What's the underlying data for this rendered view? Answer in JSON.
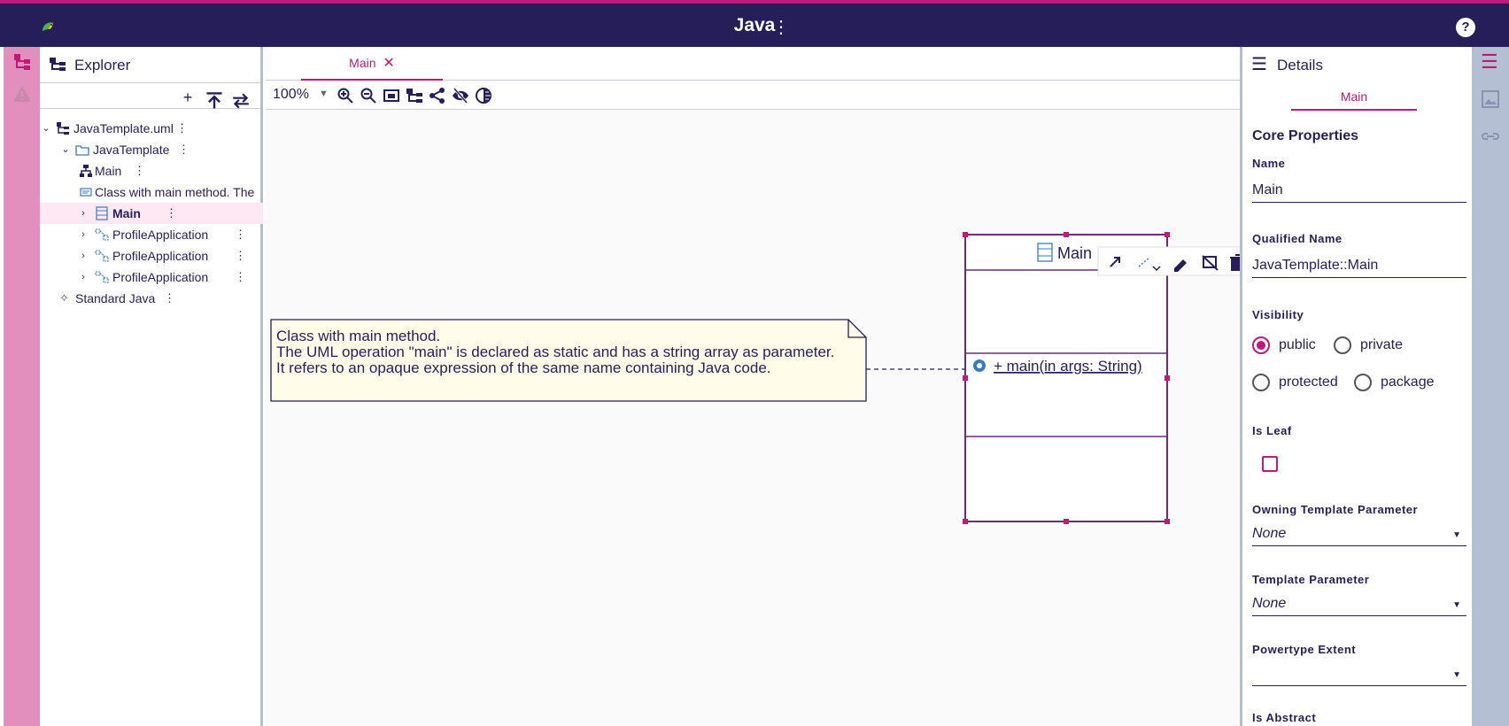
{
  "app": {
    "title": "Java"
  },
  "icons": {
    "logo": "app-logo-icon",
    "help": "help-icon",
    "menu": "more-vert-icon"
  },
  "colors": {
    "accent": "#be1a78",
    "header": "#261e58",
    "rail": "#e28fbe"
  },
  "explorer": {
    "title": "Explorer",
    "tree": [
      {
        "label": "JavaTemplate.uml",
        "icon": "model-tree-icon",
        "expanded": true
      },
      {
        "label": "JavaTemplate",
        "icon": "package-icon",
        "expanded": true
      },
      {
        "label": "Main",
        "icon": "diagram-icon"
      },
      {
        "label": "Class with main method. The",
        "icon": "comment-icon"
      },
      {
        "label": "Main",
        "icon": "class-icon",
        "selected": true
      },
      {
        "label": "ProfileApplication",
        "icon": "profile-application-icon"
      },
      {
        "label": "ProfileApplication",
        "icon": "profile-application-icon"
      },
      {
        "label": "ProfileApplication",
        "icon": "profile-application-icon"
      },
      {
        "label": "Standard Java",
        "icon": "profile-icon"
      }
    ]
  },
  "editor": {
    "tab_label": "Main",
    "zoom": "100%"
  },
  "diagram": {
    "note": {
      "lines": [
        "Class with main method.",
        "The UML operation \"main\" is declared as static and has a string array as parameter.",
        "It refers to an opaque expression of the same name containing Java code."
      ]
    },
    "class": {
      "name": "Main",
      "operation": "+ main(in args: String)"
    }
  },
  "details": {
    "title": "Details",
    "tab": "Main",
    "section": "Core Properties",
    "name_label": "Name",
    "name_value": "Main",
    "qualified_label": "Qualified Name",
    "qualified_value": "JavaTemplate::Main",
    "visibility_label": "Visibility",
    "visibility_options": [
      "public",
      "private",
      "protected",
      "package"
    ],
    "visibility_selected": "public",
    "is_leaf_label": "Is Leaf",
    "is_leaf": false,
    "owning_label": "Owning Template Parameter",
    "owning_value": "None",
    "template_label": "Template Parameter",
    "template_value": "None",
    "powertype_label": "Powertype Extent",
    "powertype_value": "",
    "abstract_label": "Is Abstract"
  }
}
